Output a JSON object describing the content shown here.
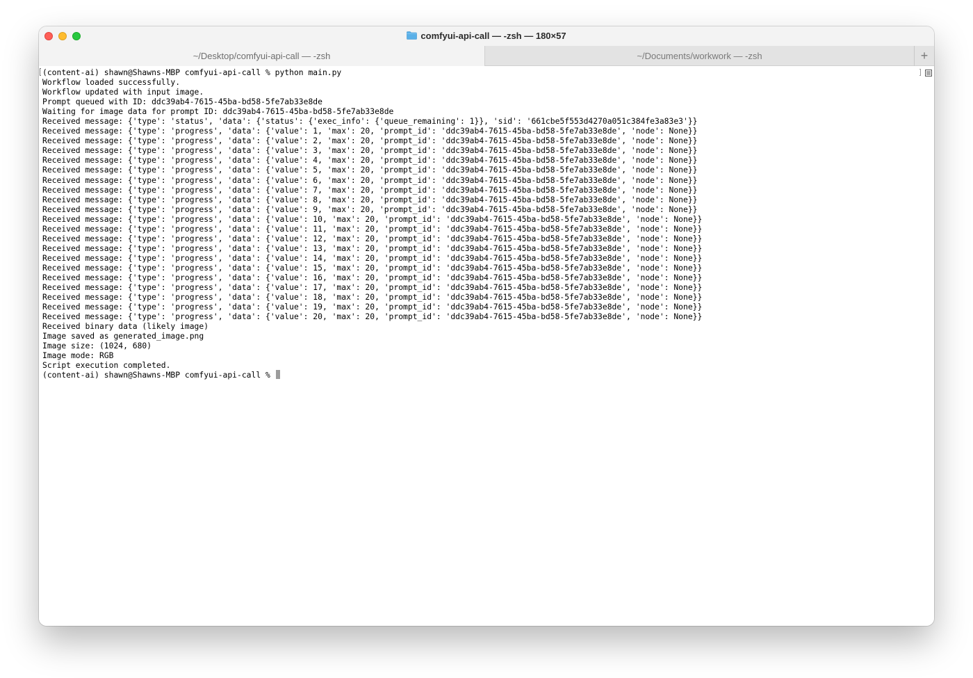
{
  "window": {
    "title": "comfyui-api-call — -zsh — 180×57",
    "colors": {
      "close": "#fe5f57",
      "minimize": "#febc2e",
      "zoom": "#28c840",
      "folder": "#5ab0e8"
    }
  },
  "tabs": [
    {
      "label": "~/Desktop/comfyui-api-call — -zsh",
      "active": true
    },
    {
      "label": "~/Documents/workwork — -zsh",
      "active": false
    }
  ],
  "tab_add_label": "+",
  "terminal": {
    "lines": [
      "(content-ai) shawn@Shawns-MBP comfyui-api-call % python main.py",
      "Workflow loaded successfully.",
      "Workflow updated with input image.",
      "Prompt queued with ID: ddc39ab4-7615-45ba-bd58-5fe7ab33e8de",
      "Waiting for image data for prompt ID: ddc39ab4-7615-45ba-bd58-5fe7ab33e8de",
      "Received message: {'type': 'status', 'data': {'status': {'exec_info': {'queue_remaining': 1}}, 'sid': '661cbe5f553d4270a051c384fe3a83e3'}}",
      "Received message: {'type': 'progress', 'data': {'value': 1, 'max': 20, 'prompt_id': 'ddc39ab4-7615-45ba-bd58-5fe7ab33e8de', 'node': None}}",
      "Received message: {'type': 'progress', 'data': {'value': 2, 'max': 20, 'prompt_id': 'ddc39ab4-7615-45ba-bd58-5fe7ab33e8de', 'node': None}}",
      "Received message: {'type': 'progress', 'data': {'value': 3, 'max': 20, 'prompt_id': 'ddc39ab4-7615-45ba-bd58-5fe7ab33e8de', 'node': None}}",
      "Received message: {'type': 'progress', 'data': {'value': 4, 'max': 20, 'prompt_id': 'ddc39ab4-7615-45ba-bd58-5fe7ab33e8de', 'node': None}}",
      "Received message: {'type': 'progress', 'data': {'value': 5, 'max': 20, 'prompt_id': 'ddc39ab4-7615-45ba-bd58-5fe7ab33e8de', 'node': None}}",
      "Received message: {'type': 'progress', 'data': {'value': 6, 'max': 20, 'prompt_id': 'ddc39ab4-7615-45ba-bd58-5fe7ab33e8de', 'node': None}}",
      "Received message: {'type': 'progress', 'data': {'value': 7, 'max': 20, 'prompt_id': 'ddc39ab4-7615-45ba-bd58-5fe7ab33e8de', 'node': None}}",
      "Received message: {'type': 'progress', 'data': {'value': 8, 'max': 20, 'prompt_id': 'ddc39ab4-7615-45ba-bd58-5fe7ab33e8de', 'node': None}}",
      "Received message: {'type': 'progress', 'data': {'value': 9, 'max': 20, 'prompt_id': 'ddc39ab4-7615-45ba-bd58-5fe7ab33e8de', 'node': None}}",
      "Received message: {'type': 'progress', 'data': {'value': 10, 'max': 20, 'prompt_id': 'ddc39ab4-7615-45ba-bd58-5fe7ab33e8de', 'node': None}}",
      "Received message: {'type': 'progress', 'data': {'value': 11, 'max': 20, 'prompt_id': 'ddc39ab4-7615-45ba-bd58-5fe7ab33e8de', 'node': None}}",
      "Received message: {'type': 'progress', 'data': {'value': 12, 'max': 20, 'prompt_id': 'ddc39ab4-7615-45ba-bd58-5fe7ab33e8de', 'node': None}}",
      "Received message: {'type': 'progress', 'data': {'value': 13, 'max': 20, 'prompt_id': 'ddc39ab4-7615-45ba-bd58-5fe7ab33e8de', 'node': None}}",
      "Received message: {'type': 'progress', 'data': {'value': 14, 'max': 20, 'prompt_id': 'ddc39ab4-7615-45ba-bd58-5fe7ab33e8de', 'node': None}}",
      "Received message: {'type': 'progress', 'data': {'value': 15, 'max': 20, 'prompt_id': 'ddc39ab4-7615-45ba-bd58-5fe7ab33e8de', 'node': None}}",
      "Received message: {'type': 'progress', 'data': {'value': 16, 'max': 20, 'prompt_id': 'ddc39ab4-7615-45ba-bd58-5fe7ab33e8de', 'node': None}}",
      "Received message: {'type': 'progress', 'data': {'value': 17, 'max': 20, 'prompt_id': 'ddc39ab4-7615-45ba-bd58-5fe7ab33e8de', 'node': None}}",
      "Received message: {'type': 'progress', 'data': {'value': 18, 'max': 20, 'prompt_id': 'ddc39ab4-7615-45ba-bd58-5fe7ab33e8de', 'node': None}}",
      "Received message: {'type': 'progress', 'data': {'value': 19, 'max': 20, 'prompt_id': 'ddc39ab4-7615-45ba-bd58-5fe7ab33e8de', 'node': None}}",
      "Received message: {'type': 'progress', 'data': {'value': 20, 'max': 20, 'prompt_id': 'ddc39ab4-7615-45ba-bd58-5fe7ab33e8de', 'node': None}}",
      "Received binary data (likely image)",
      "Image saved as generated_image.png",
      "Image size: (1024, 680)",
      "Image mode: RGB",
      "Script execution completed."
    ],
    "prompt": "(content-ai) shawn@Shawns-MBP comfyui-api-call % "
  }
}
